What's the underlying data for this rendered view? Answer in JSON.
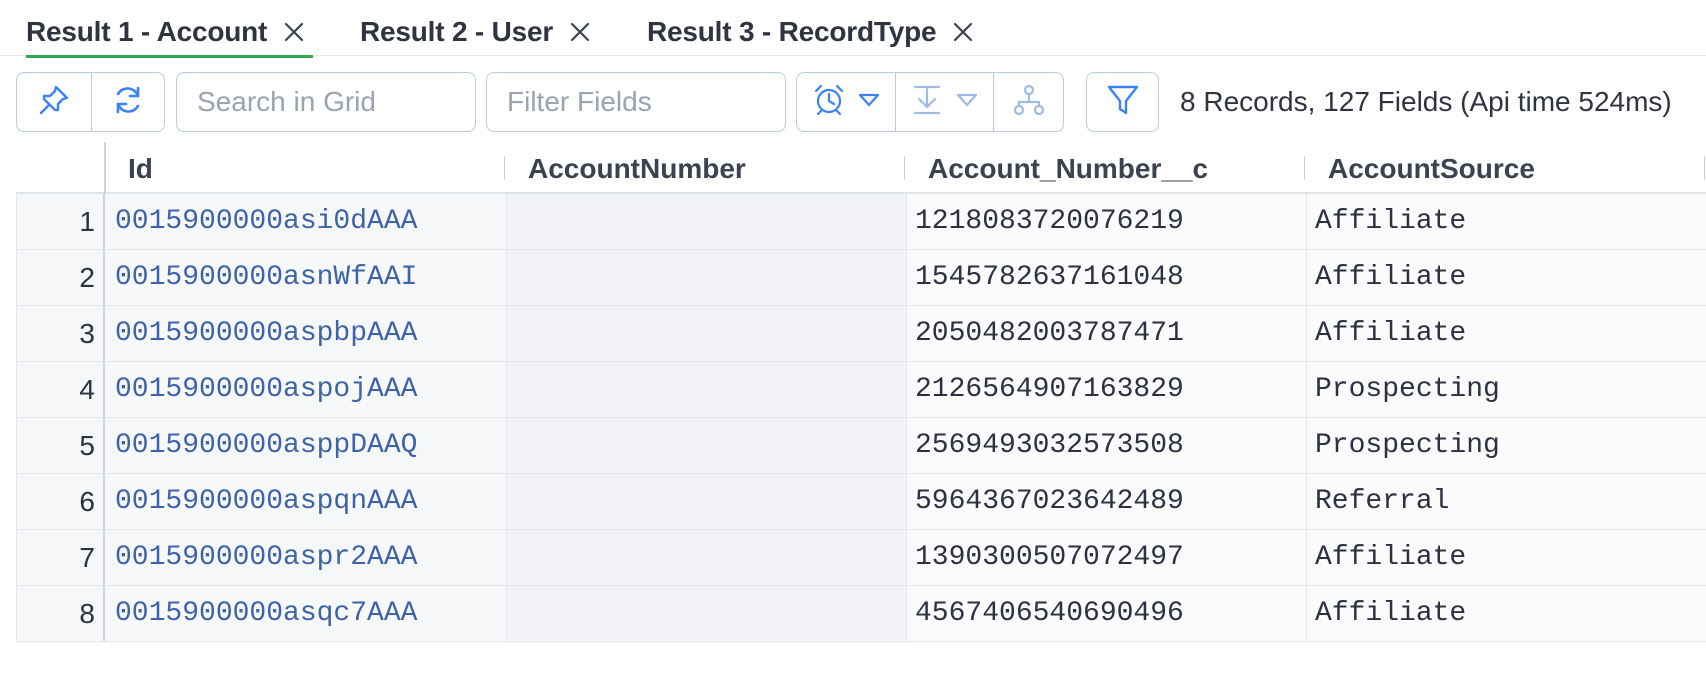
{
  "tabs": [
    {
      "label": "Result 1 - Account",
      "active": true
    },
    {
      "label": "Result 2 - User",
      "active": false
    },
    {
      "label": "Result 3 - RecordType",
      "active": false
    }
  ],
  "toolbar": {
    "pin_icon": "pin-icon",
    "refresh_icon": "refresh-icon",
    "search_placeholder": "Search in Grid",
    "filter_placeholder": "Filter Fields",
    "alarm_icon": "alarm-clock-icon",
    "download_icon": "download-icon",
    "hierarchy_icon": "hierarchy-icon",
    "filter_icon": "funnel-icon",
    "status": "8 Records, 127 Fields (Api time 524ms)"
  },
  "grid": {
    "columns": [
      "Id",
      "AccountNumber",
      "Account_Number__c",
      "AccountSource"
    ],
    "rows": [
      {
        "n": "1",
        "id": "0015900000asi0dAAA",
        "account_number": "",
        "account_number_c": "1218083720076219",
        "source": "Affiliate"
      },
      {
        "n": "2",
        "id": "0015900000asnWfAAI",
        "account_number": "",
        "account_number_c": "1545782637161048",
        "source": "Affiliate"
      },
      {
        "n": "3",
        "id": "0015900000aspbpAAA",
        "account_number": "",
        "account_number_c": "2050482003787471",
        "source": "Affiliate"
      },
      {
        "n": "4",
        "id": "0015900000aspojAAA",
        "account_number": "",
        "account_number_c": "2126564907163829",
        "source": "Prospecting"
      },
      {
        "n": "5",
        "id": "0015900000asppDAAQ",
        "account_number": "",
        "account_number_c": "2569493032573508",
        "source": "Prospecting"
      },
      {
        "n": "6",
        "id": "0015900000aspqnAAA",
        "account_number": "",
        "account_number_c": "5964367023642489",
        "source": "Referral"
      },
      {
        "n": "7",
        "id": "0015900000aspr2AAA",
        "account_number": "",
        "account_number_c": "1390300507072497",
        "source": "Affiliate"
      },
      {
        "n": "8",
        "id": "0015900000asqc7AAA",
        "account_number": "",
        "account_number_c": "4567406540690496",
        "source": "Affiliate"
      }
    ]
  },
  "colors": {
    "accent_blue": "#3b82f6",
    "active_tab_underline": "#2fa84f",
    "link_blue": "#3d63a8",
    "border": "#b8cbe4"
  }
}
